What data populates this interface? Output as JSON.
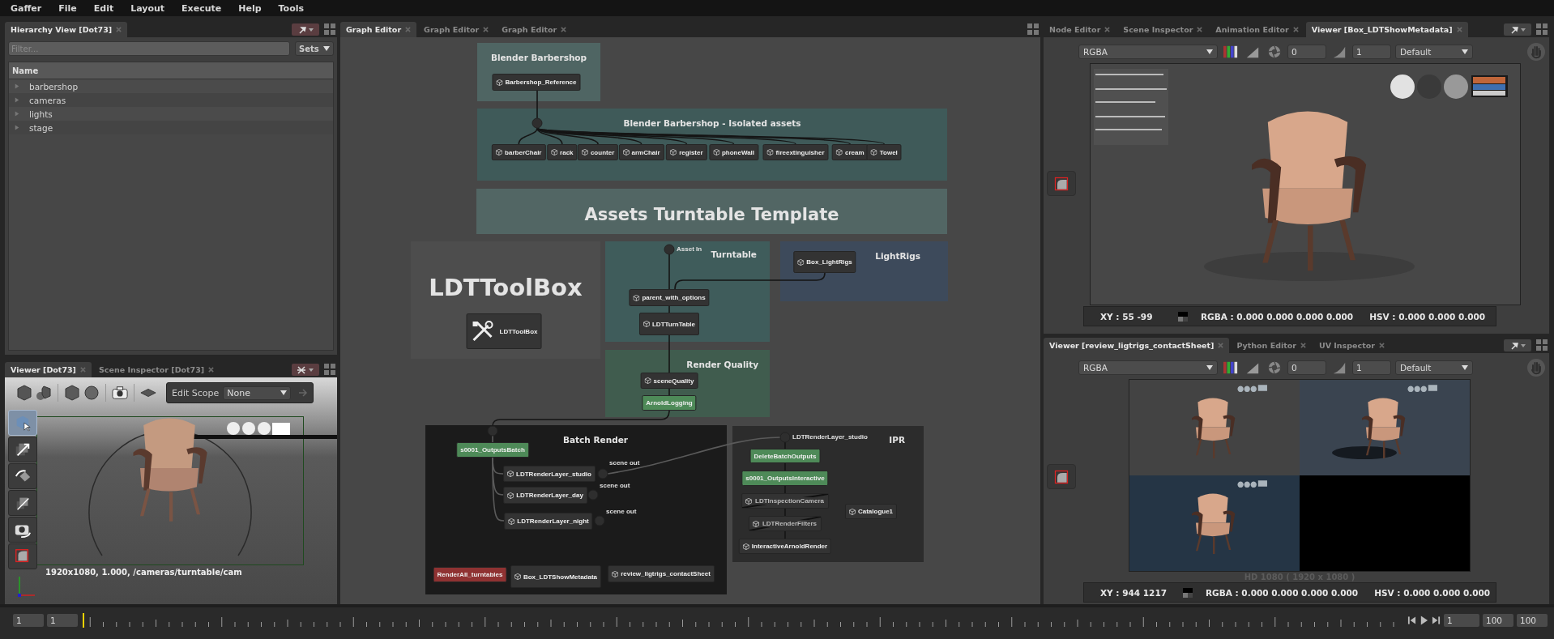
{
  "menu": [
    "Gaffer",
    "File",
    "Edit",
    "Layout",
    "Execute",
    "Help",
    "Tools"
  ],
  "hierarchy": {
    "tabs": [
      {
        "label": "Hierarchy View [Dot73]",
        "selected": true
      }
    ],
    "filter": {
      "placeholder": "Filter..."
    },
    "sets_button": "Sets",
    "column": "Name",
    "rows": [
      {
        "label": "barbershop",
        "expanded": false
      },
      {
        "label": "cameras",
        "expanded": false
      },
      {
        "label": "lights",
        "expanded": false
      },
      {
        "label": "stage",
        "expanded": false
      }
    ]
  },
  "scene_viewer": {
    "tabs": [
      {
        "label": "Viewer [Dot73]",
        "selected": true
      },
      {
        "label": "Scene Inspector [Dot73]",
        "selected": false
      }
    ],
    "edit_scope_label": "Edit Scope",
    "edit_scope_value": "None",
    "tools": [
      {
        "selected": true
      },
      {
        "selected": false
      },
      {
        "selected": false
      },
      {
        "selected": false
      },
      {
        "selected": false
      },
      {
        "selected": false
      }
    ],
    "caption": "1920x1080, 1.000, /cameras/turntable/cam"
  },
  "graph": {
    "tabs": [
      {
        "label": "Graph Editor",
        "selected": true
      },
      {
        "label": "Graph Editor",
        "selected": false
      },
      {
        "label": "Graph Editor",
        "selected": false
      }
    ],
    "backdrops": [
      {
        "title": "Blender Barbershop",
        "color": "#4f6563"
      },
      {
        "title": "Blender Barbershop - Isolated assets",
        "color": "#3f5a59"
      },
      {
        "title": "Assets Turntable Template",
        "color": "#526664"
      },
      {
        "title": "LDTToolBox",
        "color": "#4d4d4d"
      },
      {
        "title": "Turntable",
        "color": "#3f5c5b"
      },
      {
        "title": "LightRigs",
        "color": "#3d4a5b"
      },
      {
        "title": "Render Quality",
        "color": "#405c4e"
      },
      {
        "title": "Batch Render",
        "color": "#1b1b1b"
      },
      {
        "title": "IPR",
        "color": "#2c2c2c"
      }
    ],
    "nodes": [
      {
        "name": "Barbershop_Reference",
        "kind": "scene",
        "disabled": false
      },
      {
        "name": "barberChair",
        "kind": "scene",
        "disabled": false
      },
      {
        "name": "rack",
        "kind": "scene",
        "disabled": false
      },
      {
        "name": "counter",
        "kind": "scene",
        "disabled": false
      },
      {
        "name": "armChair",
        "kind": "scene",
        "disabled": false
      },
      {
        "name": "register",
        "kind": "scene",
        "disabled": false
      },
      {
        "name": "phoneWall",
        "kind": "scene",
        "disabled": false
      },
      {
        "name": "fireextinguisher",
        "kind": "scene",
        "disabled": false
      },
      {
        "name": "cream",
        "kind": "scene",
        "disabled": false
      },
      {
        "name": "Towel",
        "kind": "scene",
        "disabled": false
      },
      {
        "name": "Box_LightRigs",
        "kind": "scene",
        "disabled": false
      },
      {
        "name": "parent_with_options",
        "kind": "scene",
        "disabled": false
      },
      {
        "name": "LDTTurnTable",
        "kind": "scene",
        "disabled": false
      },
      {
        "name": "LDTToolBox",
        "kind": "tools",
        "disabled": false
      },
      {
        "name": "sceneQuality",
        "kind": "scene",
        "disabled": false
      },
      {
        "name": "ArnoldLogging",
        "kind": "task",
        "disabled": false
      },
      {
        "name": "s0001_OutputsBatch",
        "kind": "task",
        "disabled": false
      },
      {
        "name": "LDTRenderLayer_studio",
        "kind": "scene",
        "disabled": false
      },
      {
        "name": "LDTRenderLayer_day",
        "kind": "scene",
        "disabled": false
      },
      {
        "name": "LDTRenderLayer_night",
        "kind": "scene",
        "disabled": false
      },
      {
        "name": "RenderAll_turntables",
        "kind": "dispatcher",
        "disabled": false
      },
      {
        "name": "Box_LDTShowMetadata",
        "kind": "scene",
        "disabled": false
      },
      {
        "name": "review_ligtrigs_contactSheet",
        "kind": "scene",
        "disabled": false
      },
      {
        "name": "DeleteBatchOutputs",
        "kind": "task",
        "disabled": false
      },
      {
        "name": "s0001_OutputsInteractive",
        "kind": "task",
        "disabled": false
      },
      {
        "name": "LDTInspectionCamera",
        "kind": "scene",
        "disabled": true
      },
      {
        "name": "LDTRenderFilters",
        "kind": "scene",
        "disabled": true
      },
      {
        "name": "InteractiveArnoldRender",
        "kind": "scene",
        "disabled": false
      },
      {
        "name": "Catalogue1",
        "kind": "scene",
        "disabled": false
      }
    ],
    "labels": [
      "Asset In",
      "scene out",
      "scene out",
      "scene out",
      "LDTRenderLayer_studio"
    ]
  },
  "viewers": [
    {
      "tabs": [
        {
          "label": "Node Editor",
          "selected": false
        },
        {
          "label": "Scene Inspector",
          "selected": false
        },
        {
          "label": "Animation Editor",
          "selected": false
        },
        {
          "label": "Viewer [Box_LDTShowMetadata]",
          "selected": true
        }
      ],
      "channels": "RGBA",
      "exposure": "0",
      "gamma": "1",
      "display": "Default",
      "status": {
        "xy": "XY : 55 -99",
        "rgba": "RGBA : 0.000 0.000 0.000 0.000",
        "hsv": "HSV : 0.000 0.000 0.000"
      }
    },
    {
      "tabs": [
        {
          "label": "Viewer [review_ligtrigs_contactSheet]",
          "selected": true
        },
        {
          "label": "Python Editor",
          "selected": false
        },
        {
          "label": "UV Inspector",
          "selected": false
        }
      ],
      "channels": "RGBA",
      "exposure": "0",
      "gamma": "1",
      "display": "Default",
      "resolution": "HD 1080 ( 1920 x 1080 )",
      "status": {
        "xy": "XY : 944 1217",
        "rgba": "RGBA : 0.000 0.000 0.000 0.000",
        "hsv": "HSV : 0.000 0.000 0.000"
      }
    }
  ],
  "timeline": {
    "start": "1",
    "current": "1",
    "frame": "1",
    "end": "100",
    "max": "100"
  }
}
